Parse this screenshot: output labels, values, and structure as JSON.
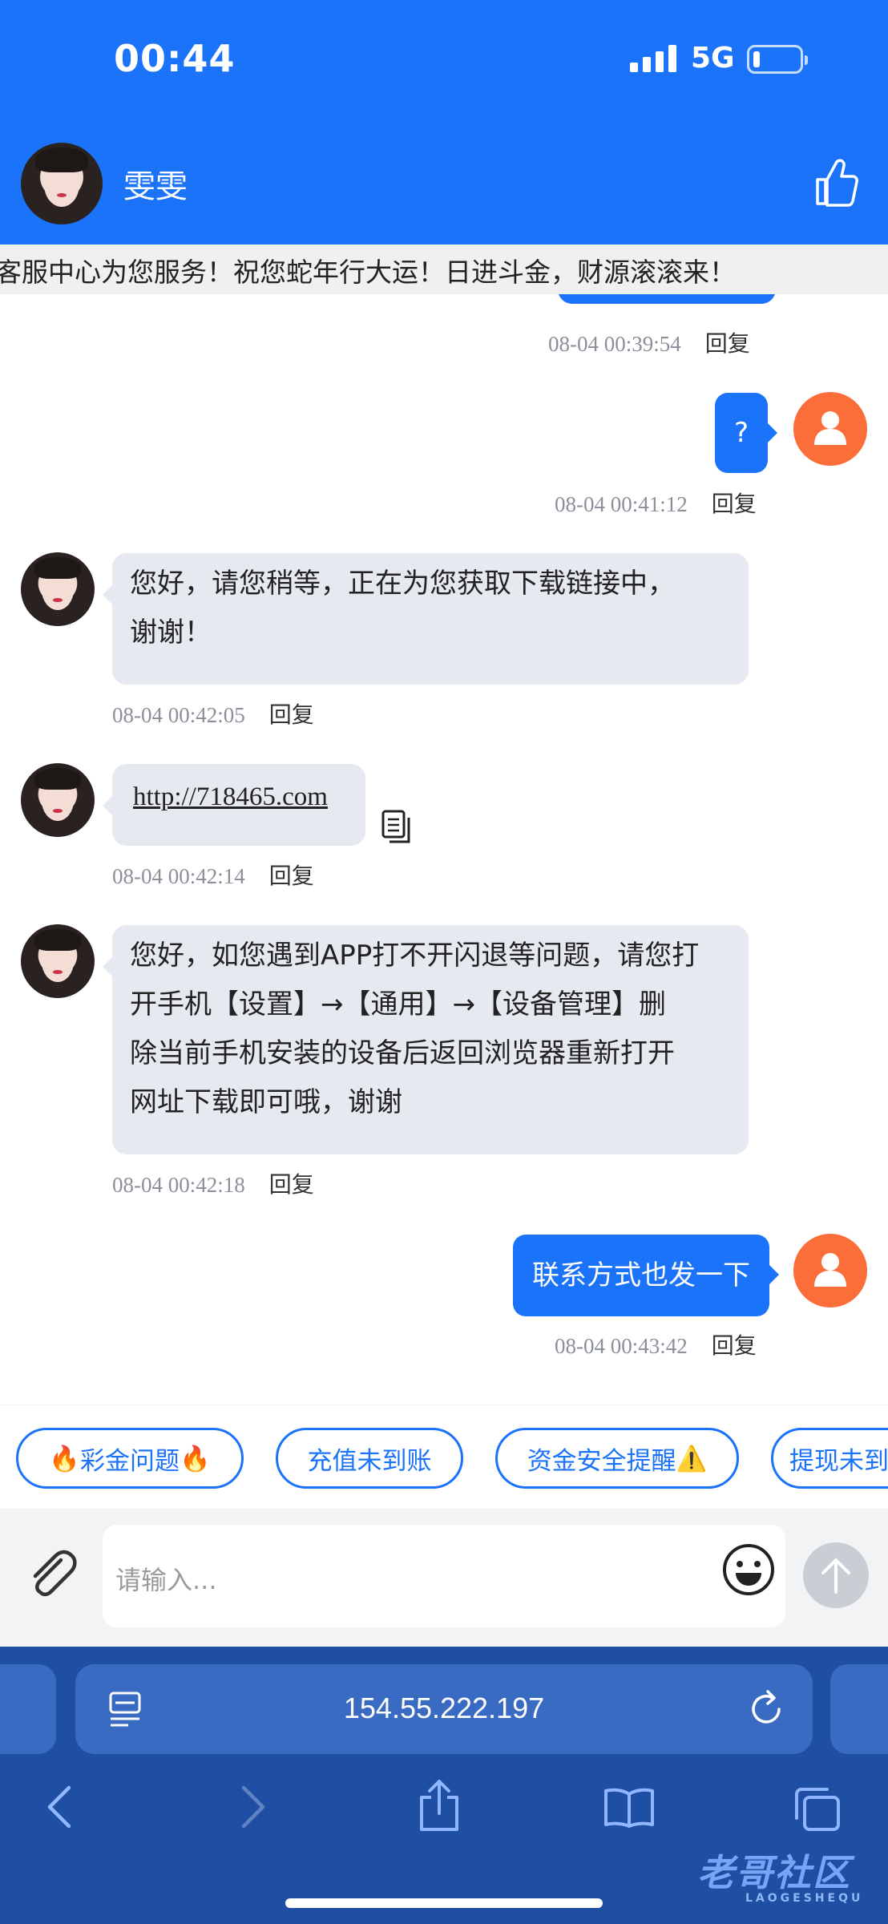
{
  "status_bar": {
    "time": "00:44",
    "network": "5G"
  },
  "header": {
    "agent_name": "雯雯"
  },
  "marquee": {
    "text": "客服中心为您服务！祝您蛇年行大运！日进斗金，财源滚滚来！"
  },
  "messages": [
    {
      "side": "out",
      "time": "08-04 00:39:54",
      "reply_label": "回复"
    },
    {
      "side": "out",
      "text": "?",
      "time": "08-04 00:41:12",
      "reply_label": "回复"
    },
    {
      "side": "in",
      "lines": [
        "您好，请您稍等，正在为您获取下载链接中，",
        "谢谢！"
      ],
      "time": "08-04 00:42:05",
      "reply_label": "回复"
    },
    {
      "side": "in",
      "text": "http://718465.com",
      "time": "08-04 00:42:14",
      "reply_label": "回复"
    },
    {
      "side": "in",
      "lines": [
        "您好，如您遇到APP打不开闪退等问题，请您打",
        "开手机【设置】→【通用】→【设备管理】删",
        "除当前手机安装的设备后返回浏览器重新打开",
        "网址下载即可哦，谢谢"
      ],
      "time": "08-04 00:42:18",
      "reply_label": "回复"
    },
    {
      "side": "out",
      "text": "联系方式也发一下",
      "time": "08-04 00:43:42",
      "reply_label": "回复"
    }
  ],
  "quick_replies": [
    {
      "prefix": "🔥",
      "label": "彩金问题",
      "suffix": "🔥"
    },
    {
      "prefix": "",
      "label": "充值未到账",
      "suffix": ""
    },
    {
      "prefix": "",
      "label": "资金安全提醒",
      "suffix": "⚠️"
    },
    {
      "prefix": "",
      "label": "提现未到",
      "suffix": ""
    }
  ],
  "input": {
    "placeholder": "请输入..."
  },
  "browser": {
    "url": "154.55.222.197"
  },
  "watermark": {
    "text": "老哥社区",
    "sub": "LAOGESHEQU"
  },
  "colors": {
    "primary": "#1a73f8",
    "user_avatar": "#fb6e3a",
    "incoming_bubble": "#e6e9f0",
    "browser_bar": "#1f4fa3"
  },
  "icons": [
    "thumbs-up-icon",
    "paperclip-icon",
    "emoji-icon",
    "send-arrow-icon",
    "copy-icon",
    "reader-icon",
    "reload-icon",
    "back-icon",
    "forward-icon",
    "share-icon",
    "bookmarks-icon",
    "tabs-icon"
  ]
}
